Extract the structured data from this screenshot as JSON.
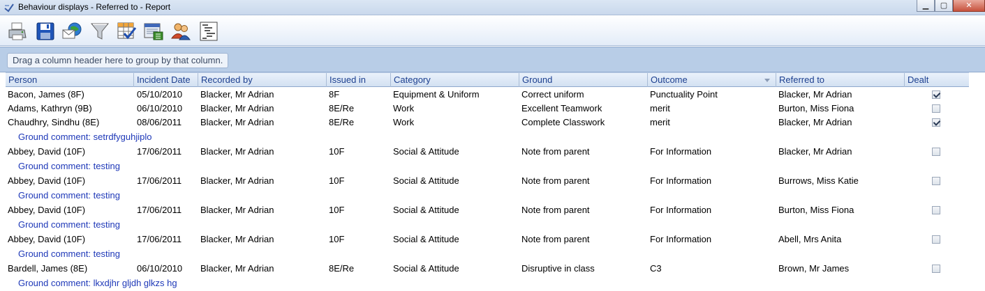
{
  "window": {
    "title": "Behaviour displays - Referred to - Report"
  },
  "toolbar": {
    "buttons": [
      {
        "icon": "printer-icon",
        "name": "print-button"
      },
      {
        "icon": "save-icon",
        "name": "save-button"
      },
      {
        "icon": "email-icon",
        "name": "email-button"
      },
      {
        "icon": "filter-icon",
        "name": "filter-button"
      },
      {
        "icon": "column-chooser-icon",
        "name": "column-chooser-button"
      },
      {
        "icon": "export-icon",
        "name": "export-button"
      },
      {
        "icon": "users-icon",
        "name": "users-button"
      },
      {
        "icon": "outline-icon",
        "name": "outline-button"
      }
    ]
  },
  "group_panel": {
    "hint": "Drag a column header here to group by that column."
  },
  "grid": {
    "columns": [
      "Person",
      "Incident Date",
      "Recorded by",
      "Issued in",
      "Category",
      "Ground",
      "Outcome",
      "Referred to",
      "Dealt"
    ],
    "rows": [
      {
        "person": "Bacon, James (8F)",
        "date": "05/10/2010",
        "recorded_by": "Blacker, Mr Adrian",
        "issued_in": "8F",
        "category": "Equipment & Uniform",
        "ground": "Correct uniform",
        "outcome": "Punctuality Point",
        "referred_to": "Blacker, Mr Adrian",
        "dealt": true,
        "comment": ""
      },
      {
        "person": "Adams, Kathryn (9B)",
        "date": "06/10/2010",
        "recorded_by": "Blacker, Mr Adrian",
        "issued_in": "8E/Re",
        "category": "Work",
        "ground": "Excellent Teamwork",
        "outcome": "merit",
        "referred_to": "Burton, Miss Fiona",
        "dealt": false,
        "comment": ""
      },
      {
        "person": "Chaudhry, Sindhu (8E)",
        "date": "08/06/2011",
        "recorded_by": "Blacker, Mr Adrian",
        "issued_in": "8E/Re",
        "category": "Work",
        "ground": "Complete Classwork",
        "outcome": "merit",
        "referred_to": "Blacker, Mr Adrian",
        "dealt": true,
        "comment": "Ground comment: setrdfyguhjiplo"
      },
      {
        "person": "Abbey, David (10F)",
        "date": "17/06/2011",
        "recorded_by": "Blacker, Mr Adrian",
        "issued_in": "10F",
        "category": "Social & Attitude",
        "ground": "Note from parent",
        "outcome": "For Information",
        "referred_to": "Blacker, Mr Adrian",
        "dealt": false,
        "comment": "Ground comment: testing"
      },
      {
        "person": "Abbey, David (10F)",
        "date": "17/06/2011",
        "recorded_by": "Blacker, Mr Adrian",
        "issued_in": "10F",
        "category": "Social & Attitude",
        "ground": "Note from parent",
        "outcome": "For Information",
        "referred_to": "Burrows, Miss Katie",
        "dealt": false,
        "comment": "Ground comment: testing"
      },
      {
        "person": "Abbey, David (10F)",
        "date": "17/06/2011",
        "recorded_by": "Blacker, Mr Adrian",
        "issued_in": "10F",
        "category": "Social & Attitude",
        "ground": "Note from parent",
        "outcome": "For Information",
        "referred_to": "Burton, Miss Fiona",
        "dealt": false,
        "comment": "Ground comment: testing"
      },
      {
        "person": "Abbey, David (10F)",
        "date": "17/06/2011",
        "recorded_by": "Blacker, Mr Adrian",
        "issued_in": "10F",
        "category": "Social & Attitude",
        "ground": "Note from parent",
        "outcome": "For Information",
        "referred_to": "Abell, Mrs Anita",
        "dealt": false,
        "comment": "Ground comment: testing"
      },
      {
        "person": "Bardell, James (8E)",
        "date": "06/10/2010",
        "recorded_by": "Blacker, Mr Adrian",
        "issued_in": "8E/Re",
        "category": "Social & Attitude",
        "ground": "Disruptive in class",
        "outcome": "C3",
        "referred_to": "Brown, Mr James",
        "dealt": false,
        "comment": "Ground comment: lkxdjhr gljdh glkzs hg"
      }
    ]
  }
}
